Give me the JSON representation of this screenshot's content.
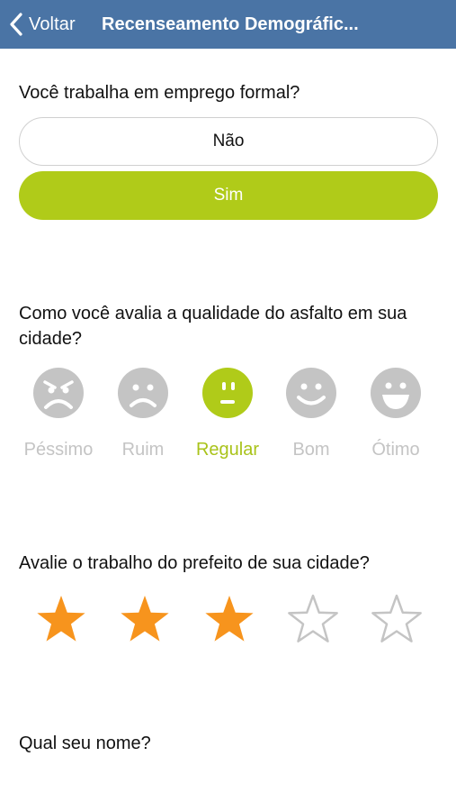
{
  "nav": {
    "back_label": "Voltar",
    "title": "Recenseamento Demográfic..."
  },
  "question1": {
    "text": "Você trabalha em emprego formal?",
    "options": [
      "Não",
      "Sim"
    ],
    "selected": "Sim"
  },
  "question2": {
    "text": "Como você avalia a qualidade do asfalto em sua cidade?",
    "options": [
      "Péssimo",
      "Ruim",
      "Regular",
      "Bom",
      "Ótimo"
    ],
    "selected": "Regular"
  },
  "question3": {
    "text": "Avalie o trabalho do prefeito de sua cidade?",
    "rating": 3,
    "max": 5
  },
  "question4": {
    "text": "Qual seu nome?"
  },
  "colors": {
    "nav": "#4a74a5",
    "accent": "#b0cb19",
    "star_filled": "#f7941d",
    "inactive": "#c4c4c4"
  }
}
